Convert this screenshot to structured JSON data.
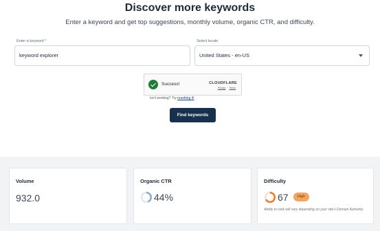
{
  "header": {
    "title": "Discover more keywords",
    "subtitle": "Enter a keyword and get top suggestions, monthly volume, organic CTR, and difficulty."
  },
  "form": {
    "keyword_label": "Enter a keyword *",
    "keyword_value": "keyword explorer",
    "locale_label": "Select locale",
    "locale_value": "United States - en-US",
    "captcha": {
      "status": "Success!",
      "brand": "CLOUDFLARE",
      "privacy_link": "Privacy",
      "terms_link": "Terms"
    },
    "not_working_prefix": "Isn't working? Try ",
    "not_working_link": "resetting it!",
    "submit_label": "Find keywords"
  },
  "metrics": {
    "volume": {
      "title": "Volume",
      "value": "932.0"
    },
    "organic_ctr": {
      "title": "Organic CTR",
      "value": "44%",
      "percent": 44
    },
    "difficulty": {
      "title": "Difficulty",
      "value": "67",
      "percent": 67,
      "badge": "High",
      "note": "Ability to rank will vary depending on your site's Domain Authority."
    }
  },
  "colors": {
    "button_bg": "#16304d",
    "success_green": "#1f7d3a",
    "ctr_ring": "#8fb0cc",
    "difficulty_ring": "#ee7d2c",
    "badge_bg": "#f2a561"
  }
}
